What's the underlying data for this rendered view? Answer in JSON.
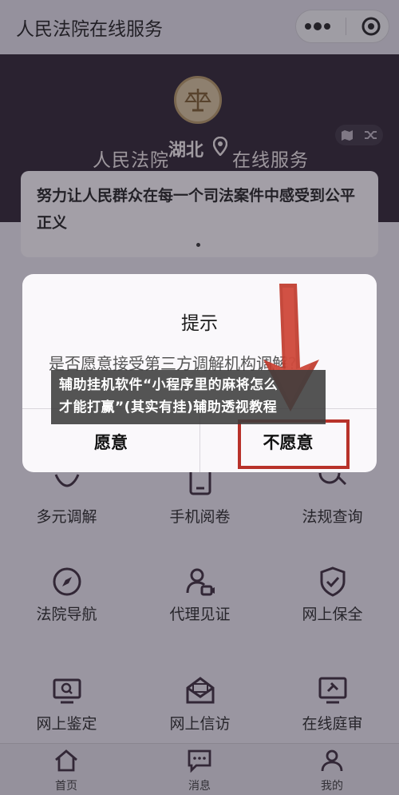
{
  "titlebar": {
    "title": "人民法院在线服务",
    "more_icon": "dots-icon",
    "close_icon": "target-icon"
  },
  "hero": {
    "court_text": "人民法院",
    "online_text": "在线服务",
    "location": "湖北"
  },
  "slogan": {
    "line1": "努力让人民群众在每一个司法案件中感受到公平",
    "line2": "正义"
  },
  "grid": {
    "items": [
      {
        "label": "多元调解",
        "icon": "mediation-icon"
      },
      {
        "label": "手机阅卷",
        "icon": "tablet-icon"
      },
      {
        "label": "法规查询",
        "icon": "search-icon"
      },
      {
        "label": "法院导航",
        "icon": "compass-icon"
      },
      {
        "label": "代理见证",
        "icon": "video-person-icon"
      },
      {
        "label": "网上保全",
        "icon": "shield-check-icon"
      },
      {
        "label": "网上鉴定",
        "icon": "monitor-icon"
      },
      {
        "label": "网上信访",
        "icon": "mail-icon"
      },
      {
        "label": "在线庭审",
        "icon": "gavel-screen-icon"
      }
    ]
  },
  "tabbar": {
    "home": "首页",
    "messages": "消息",
    "mine": "我的"
  },
  "modal": {
    "title": "提示",
    "question": "是否愿意接受第三方调解机构调解?",
    "yes": "愿意",
    "no": "不愿意"
  },
  "banner": {
    "line1": "辅助挂机软件“小程序里的麻将怎么",
    "line2": "才能打赢”(其实有挂)辅助透视教程"
  },
  "colors": {
    "hero_bg": "#2c2230",
    "highlight_red": "#b8322a",
    "emblem_gold": "#d8c39c"
  }
}
